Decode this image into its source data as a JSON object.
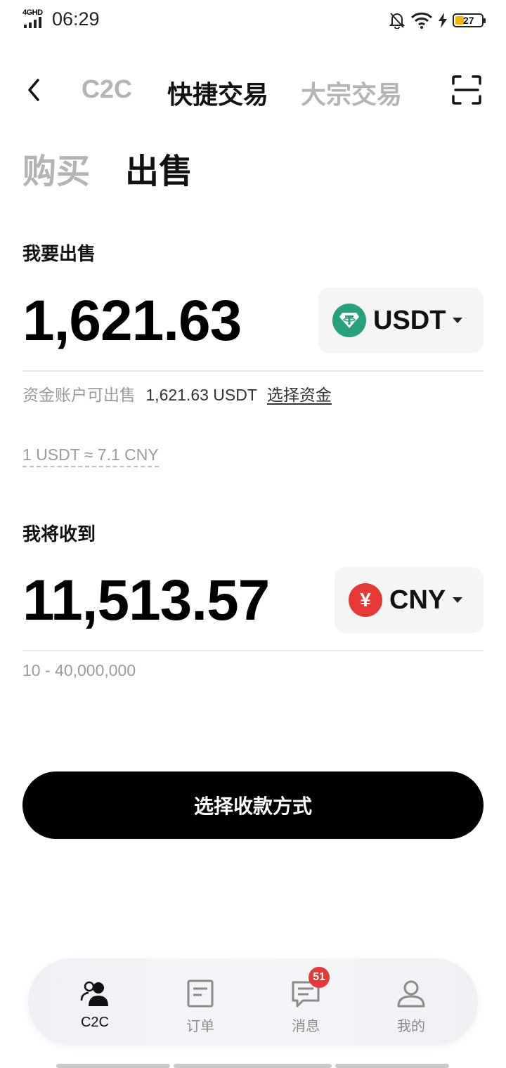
{
  "status_bar": {
    "network": "4GHD",
    "time": "06:29",
    "battery": "27"
  },
  "nav": {
    "tabs": [
      "C2C",
      "快捷交易",
      "大宗交易"
    ],
    "active_tab": "快捷交易"
  },
  "mode": {
    "buy_label": "购买",
    "sell_label": "出售",
    "active": "出售"
  },
  "sell": {
    "label": "我要出售",
    "amount": "1,621.63",
    "currency": "USDT",
    "available_label": "资金账户可出售",
    "available_value": "1,621.63 USDT",
    "select_funds_link": "选择资金"
  },
  "rate": "1 USDT ≈ 7.1 CNY",
  "receive": {
    "label": "我将收到",
    "amount": "11,513.57",
    "currency": "CNY",
    "currency_symbol": "¥",
    "range": "10 - 40,000,000"
  },
  "cta_label": "选择收款方式",
  "bottom_nav": {
    "items": [
      {
        "label": "C2C",
        "icon": "users-icon",
        "active": true
      },
      {
        "label": "订单",
        "icon": "document-icon",
        "active": false
      },
      {
        "label": "消息",
        "icon": "message-icon",
        "active": false,
        "badge": "51"
      },
      {
        "label": "我的",
        "icon": "user-icon",
        "active": false
      }
    ]
  },
  "colors": {
    "accent": "#000000",
    "usdt": "#26a17b",
    "cny": "#e53935",
    "badge": "#e53935",
    "inactive_text": "#b3b3b3"
  }
}
